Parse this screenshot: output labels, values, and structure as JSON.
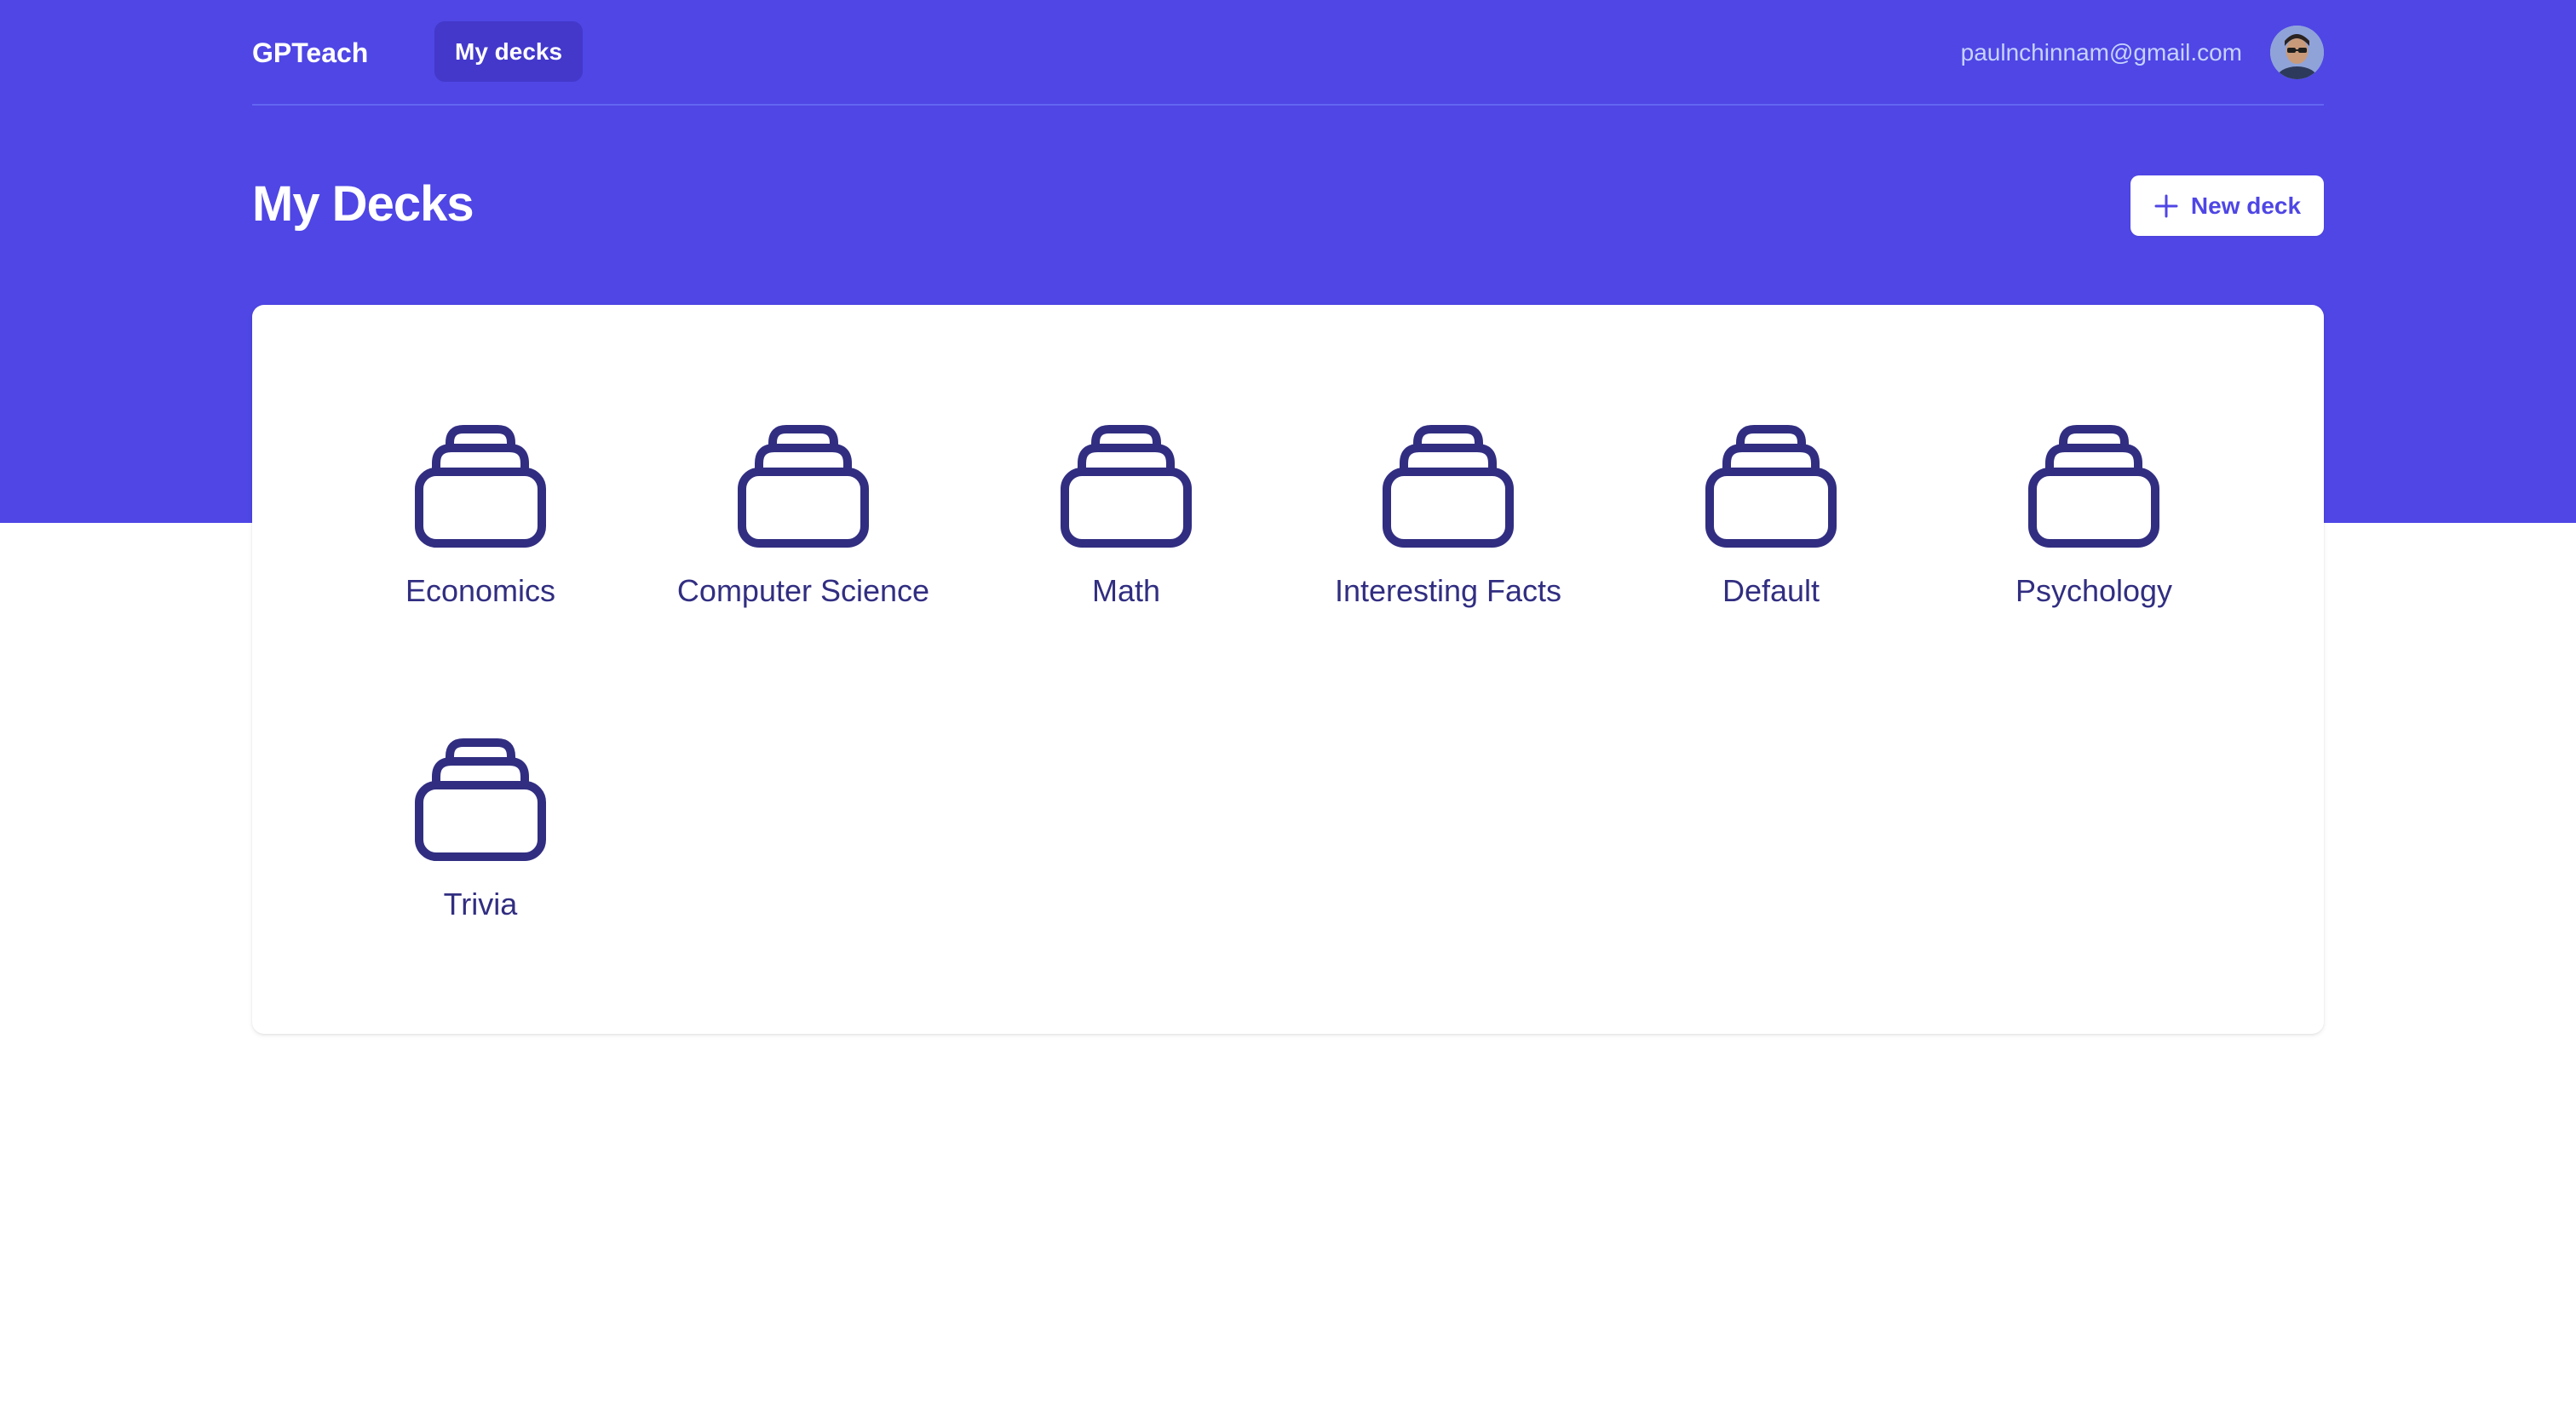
{
  "header": {
    "brand": "GPTeach",
    "nav_active": "My decks",
    "user_email": "paulnchinnam@gmail.com"
  },
  "page": {
    "title": "My Decks",
    "new_deck_label": "New deck"
  },
  "decks": [
    {
      "label": "Economics",
      "icon": "deck-icon"
    },
    {
      "label": "Computer Science",
      "icon": "deck-icon"
    },
    {
      "label": "Math",
      "icon": "deck-icon"
    },
    {
      "label": "Interesting Facts",
      "icon": "deck-icon"
    },
    {
      "label": "Default",
      "icon": "deck-icon"
    },
    {
      "label": "Psychology",
      "icon": "deck-icon"
    },
    {
      "label": "Trivia",
      "icon": "deck-icon"
    }
  ],
  "colors": {
    "brand": "#4f46e5",
    "nav_active_bg": "#4338ca",
    "deck_icon": "#312e81"
  }
}
